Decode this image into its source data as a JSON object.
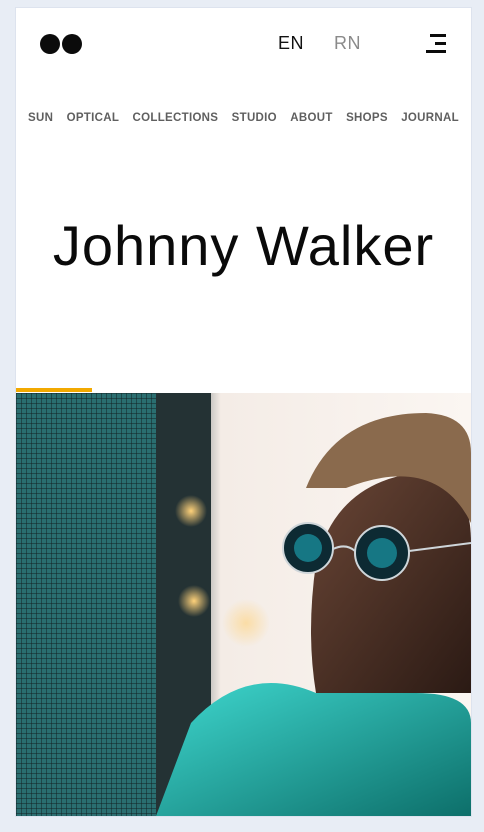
{
  "header": {
    "logo": "logo-two-dots",
    "languages": [
      {
        "code": "EN",
        "active": true
      },
      {
        "code": "RN",
        "active": false
      }
    ],
    "menu_icon": "hamburger-menu-icon"
  },
  "nav": {
    "items": [
      {
        "label": "SUN"
      },
      {
        "label": "OPTICAL"
      },
      {
        "label": "COLLECTIONS"
      },
      {
        "label": "STUDIO"
      },
      {
        "label": "ABOUT"
      },
      {
        "label": "SHOPS"
      },
      {
        "label": "JOURNAL"
      }
    ]
  },
  "hero": {
    "title": "Johnny Walker",
    "accent_color": "#f2a900"
  },
  "colors": {
    "background": "#e8edf5",
    "text": "#0a0a0a",
    "nav_text": "#5f5f5f",
    "inactive_lang": "#8a8a8a"
  }
}
